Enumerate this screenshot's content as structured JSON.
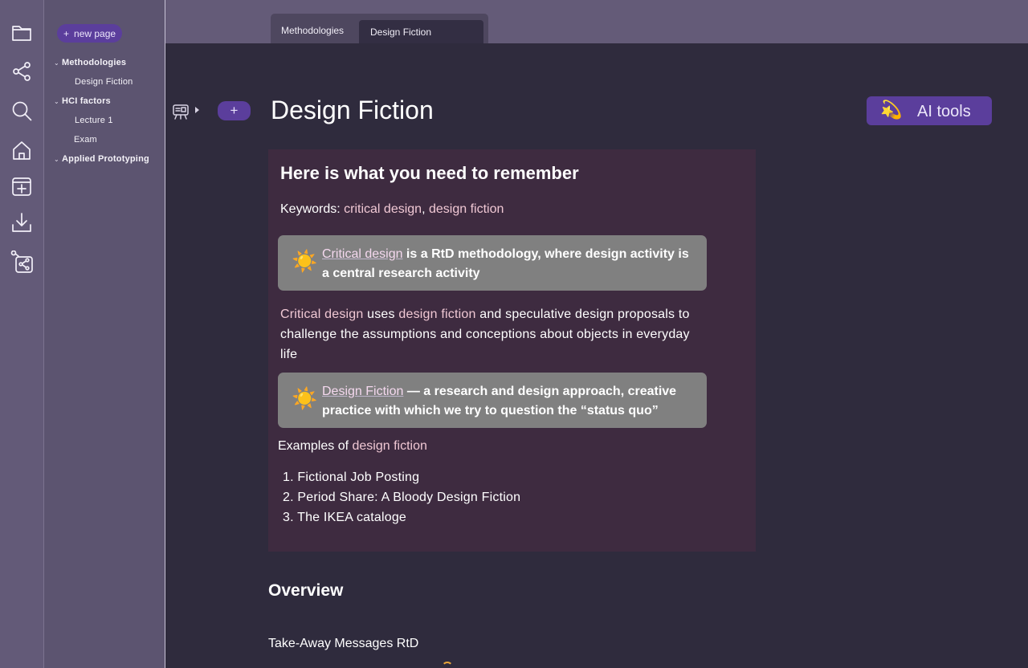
{
  "sidebar": {
    "new_page": "new page",
    "new_page_icon": "+",
    "tree": [
      {
        "label": "Methodologies",
        "expanded": true
      },
      {
        "label": "Design Fiction"
      },
      {
        "label": "HCI factors",
        "expanded": true
      },
      {
        "label": "Lecture 1"
      },
      {
        "label": "Exam"
      },
      {
        "label": "Applied Prototyping",
        "expanded": true
      }
    ]
  },
  "tabs": [
    "Methodologies",
    "Design Fiction"
  ],
  "page": {
    "title": "Design Fiction",
    "add_icon": "+",
    "ai_tools": "AI tools",
    "ai_icon": "💫"
  },
  "summary": {
    "title": "Here is what you need to remember",
    "keywords_prefix": "Keywords: ",
    "keyword_1": "critical design",
    "keyword_sep": ", ",
    "keyword_2": "design fiction",
    "callout_1": {
      "icon": "☀️",
      "link": "Critical design",
      "text": " is a RtD methodology, where design activity is a central research activity"
    },
    "para": {
      "link_1": "Critical design",
      "text_1": " uses ",
      "link_2": "design fiction",
      "text_2": " and speculative design proposals to challenge the assumptions and conceptions about objects in everyday life"
    },
    "callout_2": {
      "icon": "☀️",
      "link": "Design Fiction",
      "text": " — a research and design approach, creative practice with which we try to question the “status quo”"
    },
    "examples_prefix": "Examples of ",
    "examples_link": "design fiction",
    "examples": [
      "1. Fictional Job Posting",
      "2. Period Share: A Bloody Design Fiction",
      "3. The IKEA cataloge"
    ]
  },
  "sections": {
    "overview": "Overview",
    "takeaway": "Take-Away Messages RtD"
  },
  "colors": {
    "accent": "#5b3e9c",
    "link": "#f0c8d4",
    "panel": "#3e2b40",
    "callout": "#808080"
  }
}
